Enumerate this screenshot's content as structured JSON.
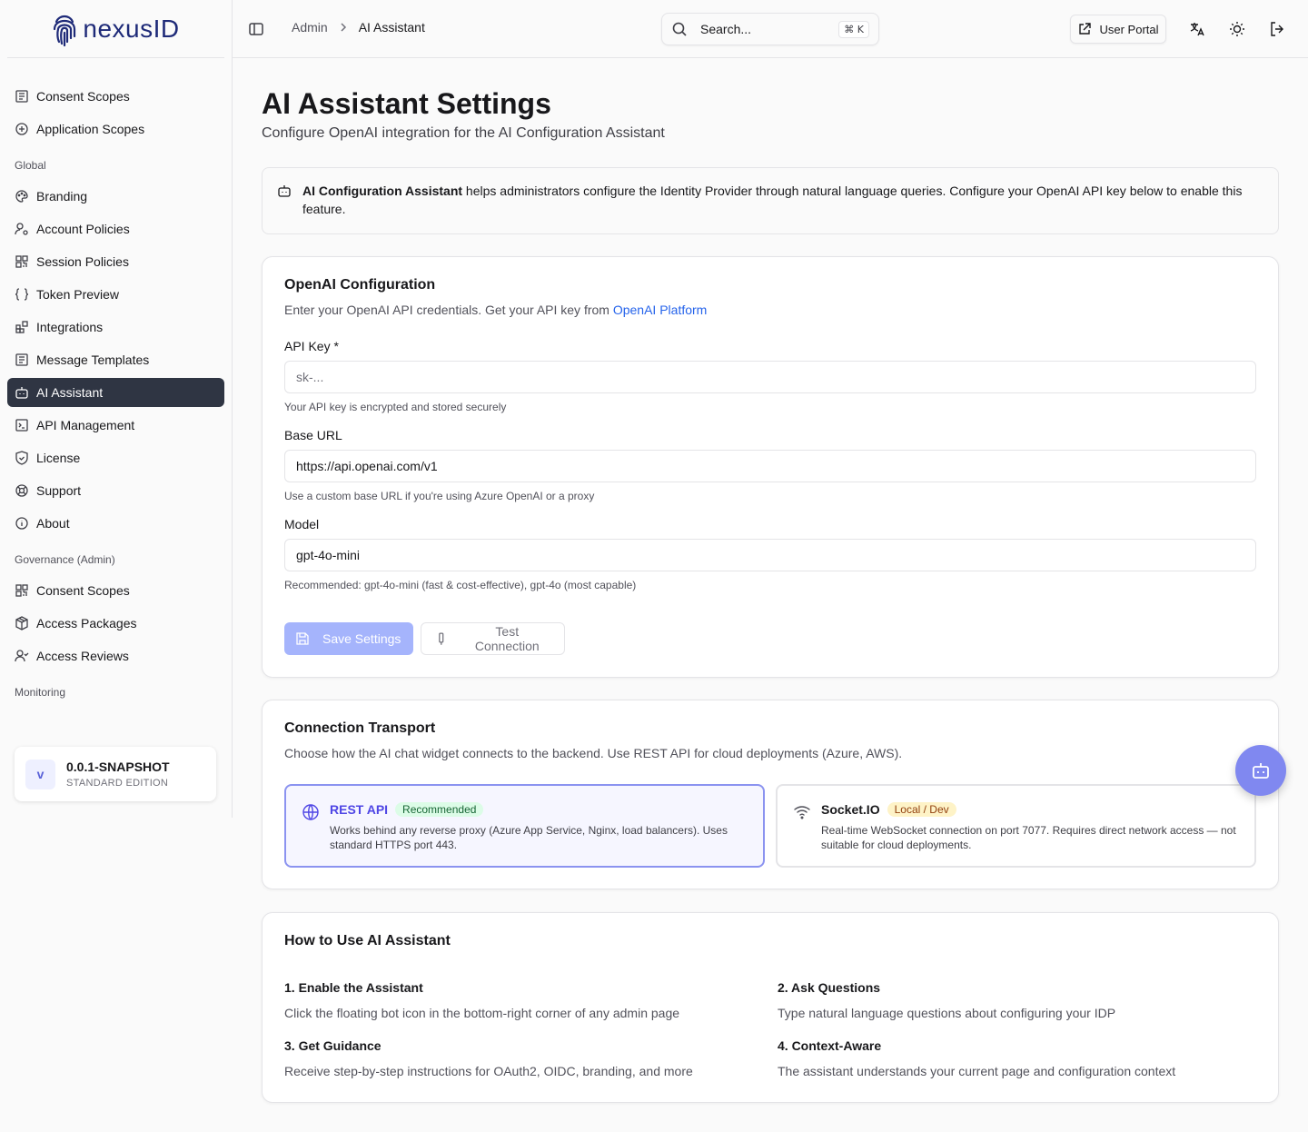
{
  "brand": {
    "logo_text_nexus": "nexus",
    "logo_text_id": "ID"
  },
  "sidebar": {
    "top_items": [
      {
        "label": "Consent Scopes",
        "icon": "list-icon"
      },
      {
        "label": "Application Scopes",
        "icon": "plus-circle-icon"
      }
    ],
    "global_label": "Global",
    "global_items": [
      {
        "label": "Branding",
        "icon": "palette-icon"
      },
      {
        "label": "Account Policies",
        "icon": "user-gear-icon"
      },
      {
        "label": "Session Policies",
        "icon": "qr-icon"
      },
      {
        "label": "Token Preview",
        "icon": "braces-icon"
      },
      {
        "label": "Integrations",
        "icon": "blocks-icon"
      },
      {
        "label": "Message Templates",
        "icon": "list-icon"
      },
      {
        "label": "AI Assistant",
        "icon": "bot-icon",
        "active": true
      },
      {
        "label": "API Management",
        "icon": "terminal-icon"
      },
      {
        "label": "License",
        "icon": "shield-icon"
      },
      {
        "label": "Support",
        "icon": "lifebuoy-icon"
      },
      {
        "label": "About",
        "icon": "info-icon"
      }
    ],
    "governance_label": "Governance (Admin)",
    "governance_items": [
      {
        "label": "Consent Scopes",
        "icon": "qr-icon"
      },
      {
        "label": "Access Packages",
        "icon": "package-icon"
      },
      {
        "label": "Access Reviews",
        "icon": "user-check-icon"
      }
    ],
    "monitoring_label": "Monitoring",
    "version": {
      "avatar": "v",
      "title": "0.0.1-SNAPSHOT",
      "edition": "STANDARD EDITION"
    }
  },
  "header": {
    "breadcrumb_parent": "Admin",
    "breadcrumb_current": "AI Assistant",
    "search_placeholder": "Search...",
    "search_shortcut": "⌘ K",
    "user_portal_label": "User Portal"
  },
  "page": {
    "title": "AI Assistant Settings",
    "subtitle": "Configure OpenAI integration for the AI Configuration Assistant",
    "info_bold": "AI Configuration Assistant",
    "info_text": " helps administrators configure the Identity Provider through natural language queries. Configure your OpenAI API key below to enable this feature."
  },
  "openai": {
    "title": "OpenAI Configuration",
    "desc_prefix": "Enter your OpenAI API credentials. Get your API key from ",
    "desc_link": "OpenAI Platform",
    "api_key_label": "API Key *",
    "api_key_placeholder": "sk-...",
    "api_key_help": "Your API key is encrypted and stored securely",
    "base_url_label": "Base URL",
    "base_url_value": "https://api.openai.com/v1",
    "base_url_help": "Use a custom base URL if you're using Azure OpenAI or a proxy",
    "model_label": "Model",
    "model_value": "gpt-4o-mini",
    "model_help": "Recommended: gpt-4o-mini (fast & cost-effective), gpt-4o (most capable)",
    "save_label": "Save Settings",
    "test_label": "Test Connection"
  },
  "transport": {
    "title": "Connection Transport",
    "desc": "Choose how the AI chat widget connects to the backend. Use REST API for cloud deployments (Azure, AWS).",
    "rest": {
      "title": "REST API",
      "badge": "Recommended",
      "desc": "Works behind any reverse proxy (Azure App Service, Nginx, load balancers). Uses standard HTTPS port 443."
    },
    "socket": {
      "title": "Socket.IO",
      "badge": "Local / Dev",
      "desc": "Real-time WebSocket connection on port 7077. Requires direct network access — not suitable for cloud deployments."
    }
  },
  "howto": {
    "title": "How to Use AI Assistant",
    "items": [
      {
        "title": "1. Enable the Assistant",
        "desc": "Click the floating bot icon in the bottom-right corner of any admin page"
      },
      {
        "title": "2. Ask Questions",
        "desc": "Type natural language questions about configuring your IDP"
      },
      {
        "title": "3. Get Guidance",
        "desc": "Receive step-by-step instructions for OAuth2, OIDC, branding, and more"
      },
      {
        "title": "4. Context-Aware",
        "desc": "The assistant understands your current page and configuration context"
      }
    ]
  },
  "colors": {
    "accent": "#4f46e5",
    "active_nav": "#2f3543",
    "fab": "#8088f0",
    "link": "#2563eb"
  }
}
